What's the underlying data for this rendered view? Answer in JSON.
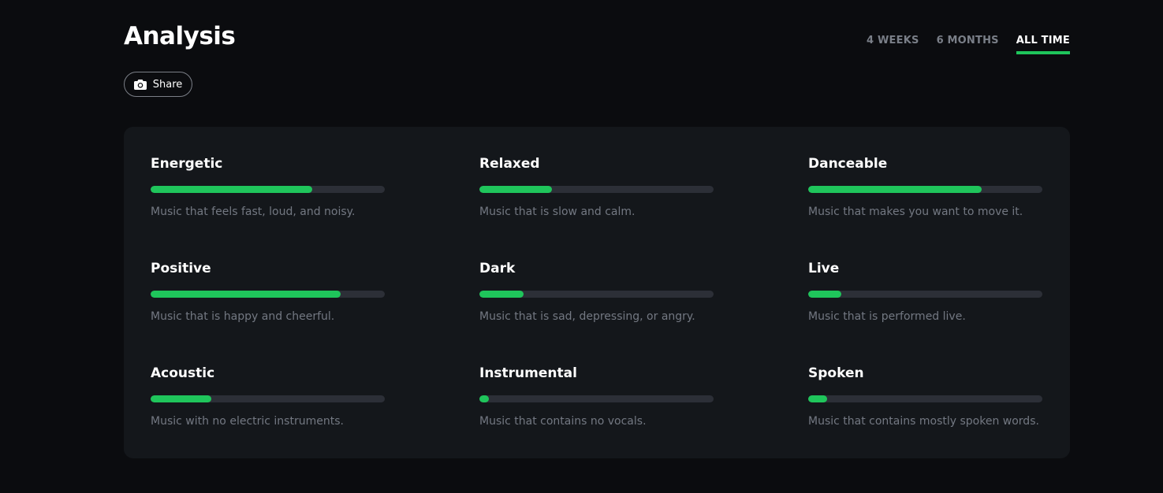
{
  "header": {
    "title": "Analysis",
    "share_label": "Share"
  },
  "tabs": [
    {
      "label": "4 WEEKS",
      "active": false
    },
    {
      "label": "6 MONTHS",
      "active": false
    },
    {
      "label": "ALL TIME",
      "active": true
    }
  ],
  "colors": {
    "accent": "#1fc55b",
    "track": "#2c2f37",
    "card": "#14171b",
    "background": "#0b0c0f"
  },
  "features": [
    {
      "name": "Energetic",
      "value": 0.69,
      "description": "Music that feels fast, loud, and noisy."
    },
    {
      "name": "Relaxed",
      "value": 0.31,
      "description": "Music that is slow and calm."
    },
    {
      "name": "Danceable",
      "value": 0.74,
      "description": "Music that makes you want to move it."
    },
    {
      "name": "Positive",
      "value": 0.81,
      "description": "Music that is happy and cheerful."
    },
    {
      "name": "Dark",
      "value": 0.19,
      "description": "Music that is sad, depressing, or angry."
    },
    {
      "name": "Live",
      "value": 0.14,
      "description": "Music that is performed live."
    },
    {
      "name": "Acoustic",
      "value": 0.26,
      "description": "Music with no electric instruments."
    },
    {
      "name": "Instrumental",
      "value": 0.04,
      "description": "Music that contains no vocals."
    },
    {
      "name": "Spoken",
      "value": 0.08,
      "description": "Music that contains mostly spoken words."
    }
  ]
}
